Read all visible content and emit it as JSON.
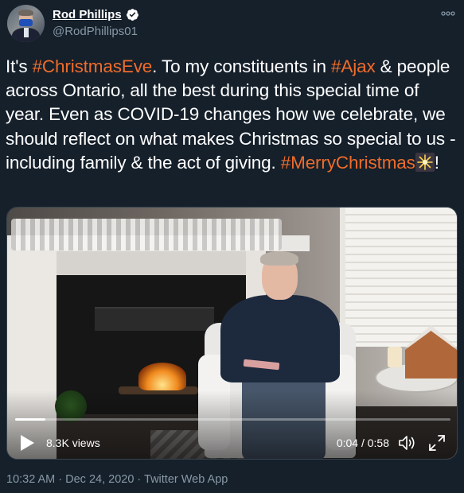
{
  "author": {
    "display_name": "Rod Phillips",
    "handle": "@RodPhillips01",
    "avatar_icon": "avatar-photo",
    "verified_icon": "verified-badge-icon"
  },
  "tweet": {
    "segments": [
      {
        "text": "It's ",
        "type": "text"
      },
      {
        "text": "#ChristmasEve",
        "type": "hashtag"
      },
      {
        "text": ". To my constituents in ",
        "type": "text"
      },
      {
        "text": "#Ajax",
        "type": "hashtag"
      },
      {
        "text": " & people across Ontario, all the best during this special time of year. Even as COVID-19 changes how we celebrate, we should reflect on what makes Christmas so special to us - including family & the act of giving. ",
        "type": "text"
      },
      {
        "text": "#MerryChristmas",
        "type": "hashtag"
      },
      {
        "text": "!",
        "type": "text"
      }
    ],
    "hashtag_color": "#ef6c2a",
    "emoji": "sparkler-emoji"
  },
  "video": {
    "views": "8.3K views",
    "time": "0:04 / 0:58",
    "progress": 0.069,
    "play_icon": "play-icon",
    "volume_icon": "volume-icon",
    "fullscreen_icon": "fullscreen-icon"
  },
  "footer": {
    "meta": "10:32 AM · Dec 24, 2020 · Twitter Web App"
  },
  "colors": {
    "background": "#15202b",
    "secondary_text": "#8899a6",
    "verified_badge": "#ffffff"
  }
}
